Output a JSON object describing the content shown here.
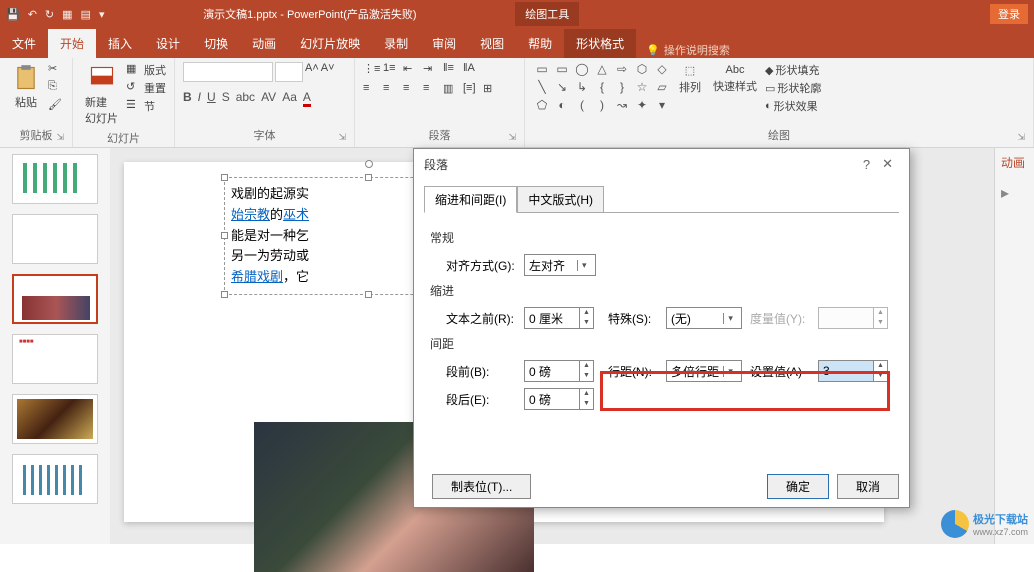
{
  "titlebar": {
    "document_title": "演示文稿1.pptx",
    "app_name": "PowerPoint(产品激活失败)",
    "drawing_tools": "绘图工具",
    "login": "登录"
  },
  "tabs": {
    "file": "文件",
    "home": "开始",
    "insert": "插入",
    "design": "设计",
    "transitions": "切换",
    "animations": "动画",
    "slideshow": "幻灯片放映",
    "record": "录制",
    "review": "审阅",
    "view": "视图",
    "help": "帮助",
    "format": "形状格式",
    "tellme": "操作说明搜索"
  },
  "ribbon": {
    "clipboard": {
      "label": "剪贴板",
      "paste": "粘贴"
    },
    "slides": {
      "label": "幻灯片",
      "new_slide": "新建\n幻灯片",
      "layout": "版式",
      "reset": "重置",
      "section": "节"
    },
    "font": {
      "label": "字体"
    },
    "paragraph": {
      "label": "段落"
    },
    "drawing": {
      "label": "绘图",
      "arrange": "排列",
      "quick_styles": "快速样式",
      "fill": "形状填充",
      "outline": "形状轮廓",
      "effects": "形状效果"
    }
  },
  "slide_text": {
    "line1_a": "戏剧的起源实",
    "line2_a": "始宗教",
    "line2_b": "的",
    "line2_c": "巫术",
    "line3_a": "能是对一种乞",
    "line4_a": "另一为劳动或",
    "line5_a": "希腊戏剧",
    "line5_b": "，它"
  },
  "dialog": {
    "title": "段落",
    "tab_indent": "缩进和间距(I)",
    "tab_cjk": "中文版式(H)",
    "general": "常规",
    "alignment_label": "对齐方式(G):",
    "alignment_value": "左对齐",
    "indent": "缩进",
    "before_text_label": "文本之前(R):",
    "before_text_value": "0 厘米",
    "special_label": "特殊(S):",
    "special_value": "(无)",
    "by_label": "度量值(Y):",
    "spacing": "间距",
    "before_label": "段前(B):",
    "before_value": "0 磅",
    "after_label": "段后(E):",
    "after_value": "0 磅",
    "line_spacing_label": "行距(N):",
    "line_spacing_value": "多倍行距",
    "at_label": "设置值(A)",
    "at_value": "3",
    "tabs_btn": "制表位(T)...",
    "ok": "确定",
    "cancel": "取消"
  },
  "side_pane": {
    "title": "动画"
  },
  "watermark": {
    "text": "极光下载站",
    "url": "www.xz7.com"
  }
}
